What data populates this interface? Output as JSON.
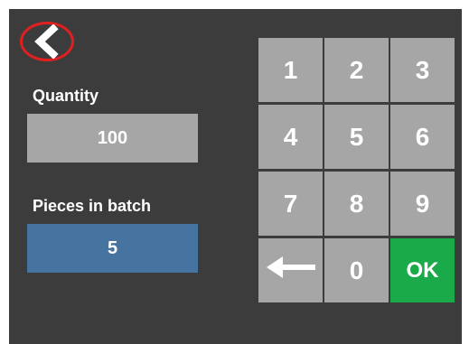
{
  "back_icon": "chevron-left-icon",
  "quantity": {
    "label": "Quantity",
    "value": "100"
  },
  "pieces": {
    "label": "Pieces in batch",
    "value": "5"
  },
  "keypad": {
    "keys": [
      "1",
      "2",
      "3",
      "4",
      "5",
      "6",
      "7",
      "8",
      "9"
    ],
    "backspace_icon": "left-arrow-icon",
    "zero": "0",
    "ok": "OK"
  },
  "colors": {
    "screen_bg": "#3c3c3c",
    "key_bg": "#a6a6a6",
    "selected_field_bg": "#4673a0",
    "ok_bg": "#1aaa4a",
    "back_ring": "#e02020"
  }
}
